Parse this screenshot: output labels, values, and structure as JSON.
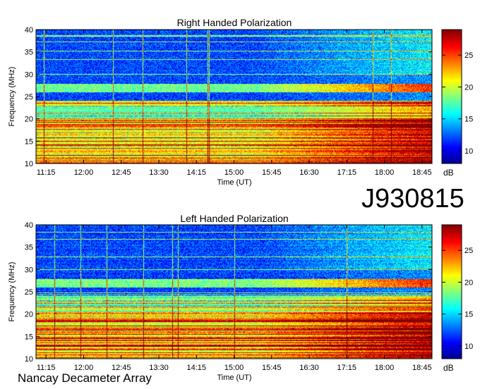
{
  "observation_id": "J930815",
  "instrument": "Nancay Decameter Array",
  "chart_data": [
    {
      "type": "heatmap",
      "title": "Right Handed Polarization",
      "xlabel": "Time (UT)",
      "ylabel": "Frequency (MHz)",
      "x_ticks": [
        "11:15",
        "12:00",
        "12:45",
        "13:30",
        "14:15",
        "15:00",
        "15:45",
        "16:30",
        "17:15",
        "18:00",
        "18:45"
      ],
      "y_ticks": [
        10,
        15,
        20,
        25,
        30,
        35,
        40
      ],
      "ylim": [
        10,
        40
      ],
      "colorbar": {
        "label": "dB",
        "ticks": [
          10,
          15,
          20,
          25
        ],
        "range": [
          8,
          29
        ]
      }
    },
    {
      "type": "heatmap",
      "title": "Left Handed Polarization",
      "xlabel": "Time (UT)",
      "ylabel": "Frequency (MHz)",
      "x_ticks": [
        "11:15",
        "12:00",
        "12:45",
        "13:30",
        "14:15",
        "15:00",
        "15:45",
        "16:30",
        "17:15",
        "18:00",
        "18:45"
      ],
      "y_ticks": [
        10,
        15,
        20,
        25,
        30,
        35,
        40
      ],
      "ylim": [
        10,
        40
      ],
      "colorbar": {
        "label": "dB",
        "ticks": [
          10,
          15,
          20,
          25
        ],
        "range": [
          8,
          29
        ]
      }
    }
  ]
}
